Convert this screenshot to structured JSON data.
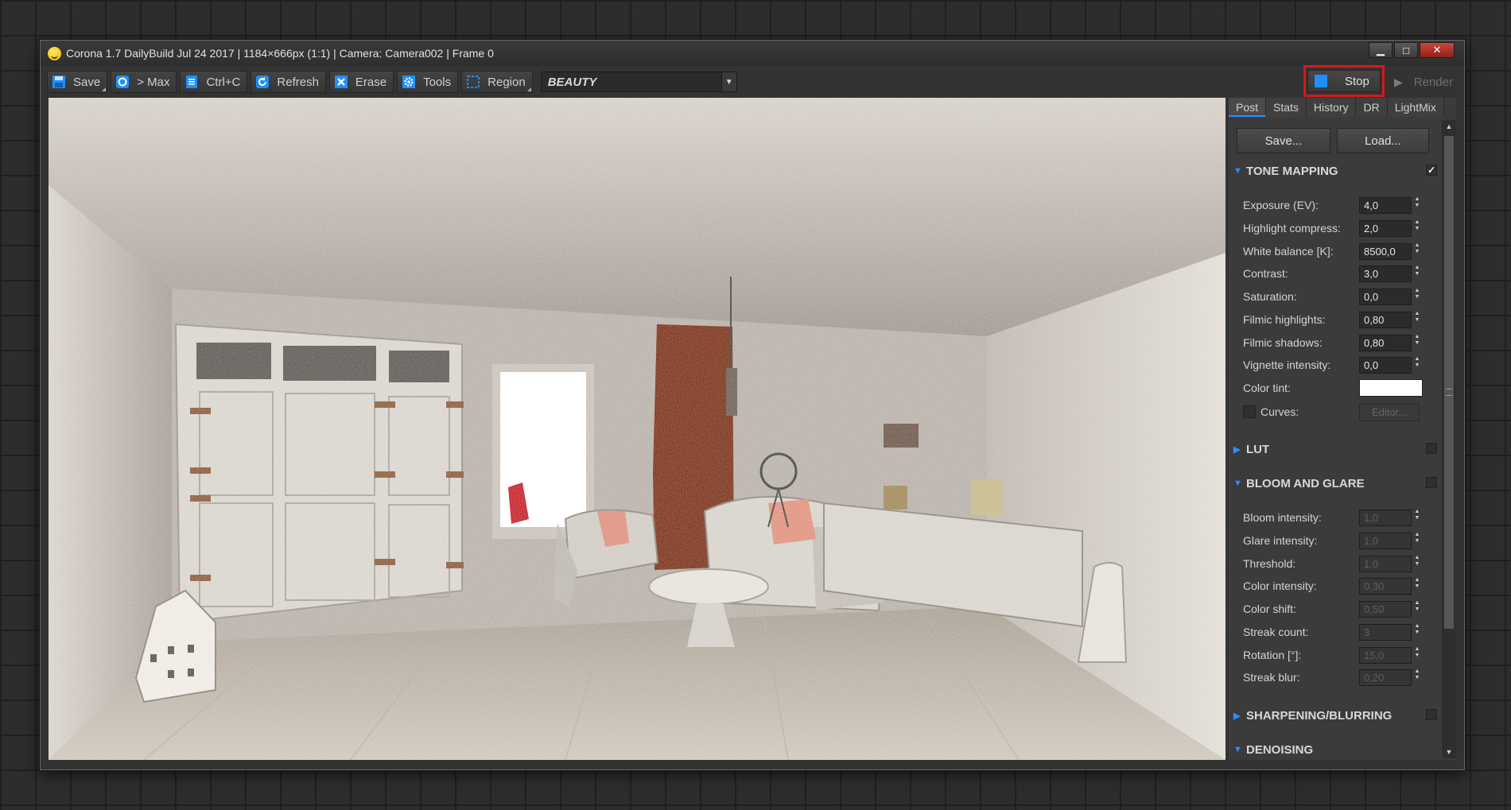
{
  "window": {
    "title": "Corona 1.7 DailyBuild Jul 24 2017 | 1184×666px (1:1) | Camera: Camera002 | Frame 0",
    "controls": [
      "minimize",
      "maximize",
      "close"
    ]
  },
  "toolbar": {
    "save_label": "Save",
    "max_label": "> Max",
    "copy_label": "Ctrl+C",
    "refresh_label": "Refresh",
    "erase_label": "Erase",
    "tools_label": "Tools",
    "region_label": "Region",
    "pass_value": "BEAUTY",
    "stop_label": "Stop",
    "render_label": "Render"
  },
  "panel": {
    "tabs": [
      "Post",
      "Stats",
      "History",
      "DR",
      "LightMix"
    ],
    "active_tab": "Post",
    "save_button": "Save...",
    "load_button": "Load...",
    "tone_mapping": {
      "title": "TONE MAPPING",
      "enabled": true,
      "rows": [
        {
          "label": "Exposure (EV):",
          "value": "4,0"
        },
        {
          "label": "Highlight compress:",
          "value": "2,0"
        },
        {
          "label": "White balance [K]:",
          "value": "8500,0"
        },
        {
          "label": "Contrast:",
          "value": "3,0"
        },
        {
          "label": "Saturation:",
          "value": "0,0"
        },
        {
          "label": "Filmic highlights:",
          "value": "0,80"
        },
        {
          "label": "Filmic shadows:",
          "value": "0,80"
        },
        {
          "label": "Vignette intensity:",
          "value": "0,0"
        }
      ],
      "color_tint_label": "Color tint:",
      "color_tint_value": "#ffffff",
      "curves_label": "Curves:",
      "editor_label": "Editor..."
    },
    "lut": {
      "title": "LUT"
    },
    "bloom_glare": {
      "title": "BLOOM AND GLARE",
      "rows": [
        {
          "label": "Bloom intensity:",
          "value": "1,0"
        },
        {
          "label": "Glare intensity:",
          "value": "1,0"
        },
        {
          "label": "Threshold:",
          "value": "1,0"
        },
        {
          "label": "Color intensity:",
          "value": "0,30"
        },
        {
          "label": "Color shift:",
          "value": "0,50"
        },
        {
          "label": "Streak count:",
          "value": "3"
        },
        {
          "label": "Rotation [°]:",
          "value": "15,0"
        },
        {
          "label": "Streak blur:",
          "value": "0,20"
        }
      ]
    },
    "sharpening": {
      "title": "SHARPENING/BLURRING"
    },
    "denoising": {
      "title": "DENOISING"
    }
  },
  "colors": {
    "accent": "#2a8fff",
    "stop_highlight": "#d81818"
  }
}
